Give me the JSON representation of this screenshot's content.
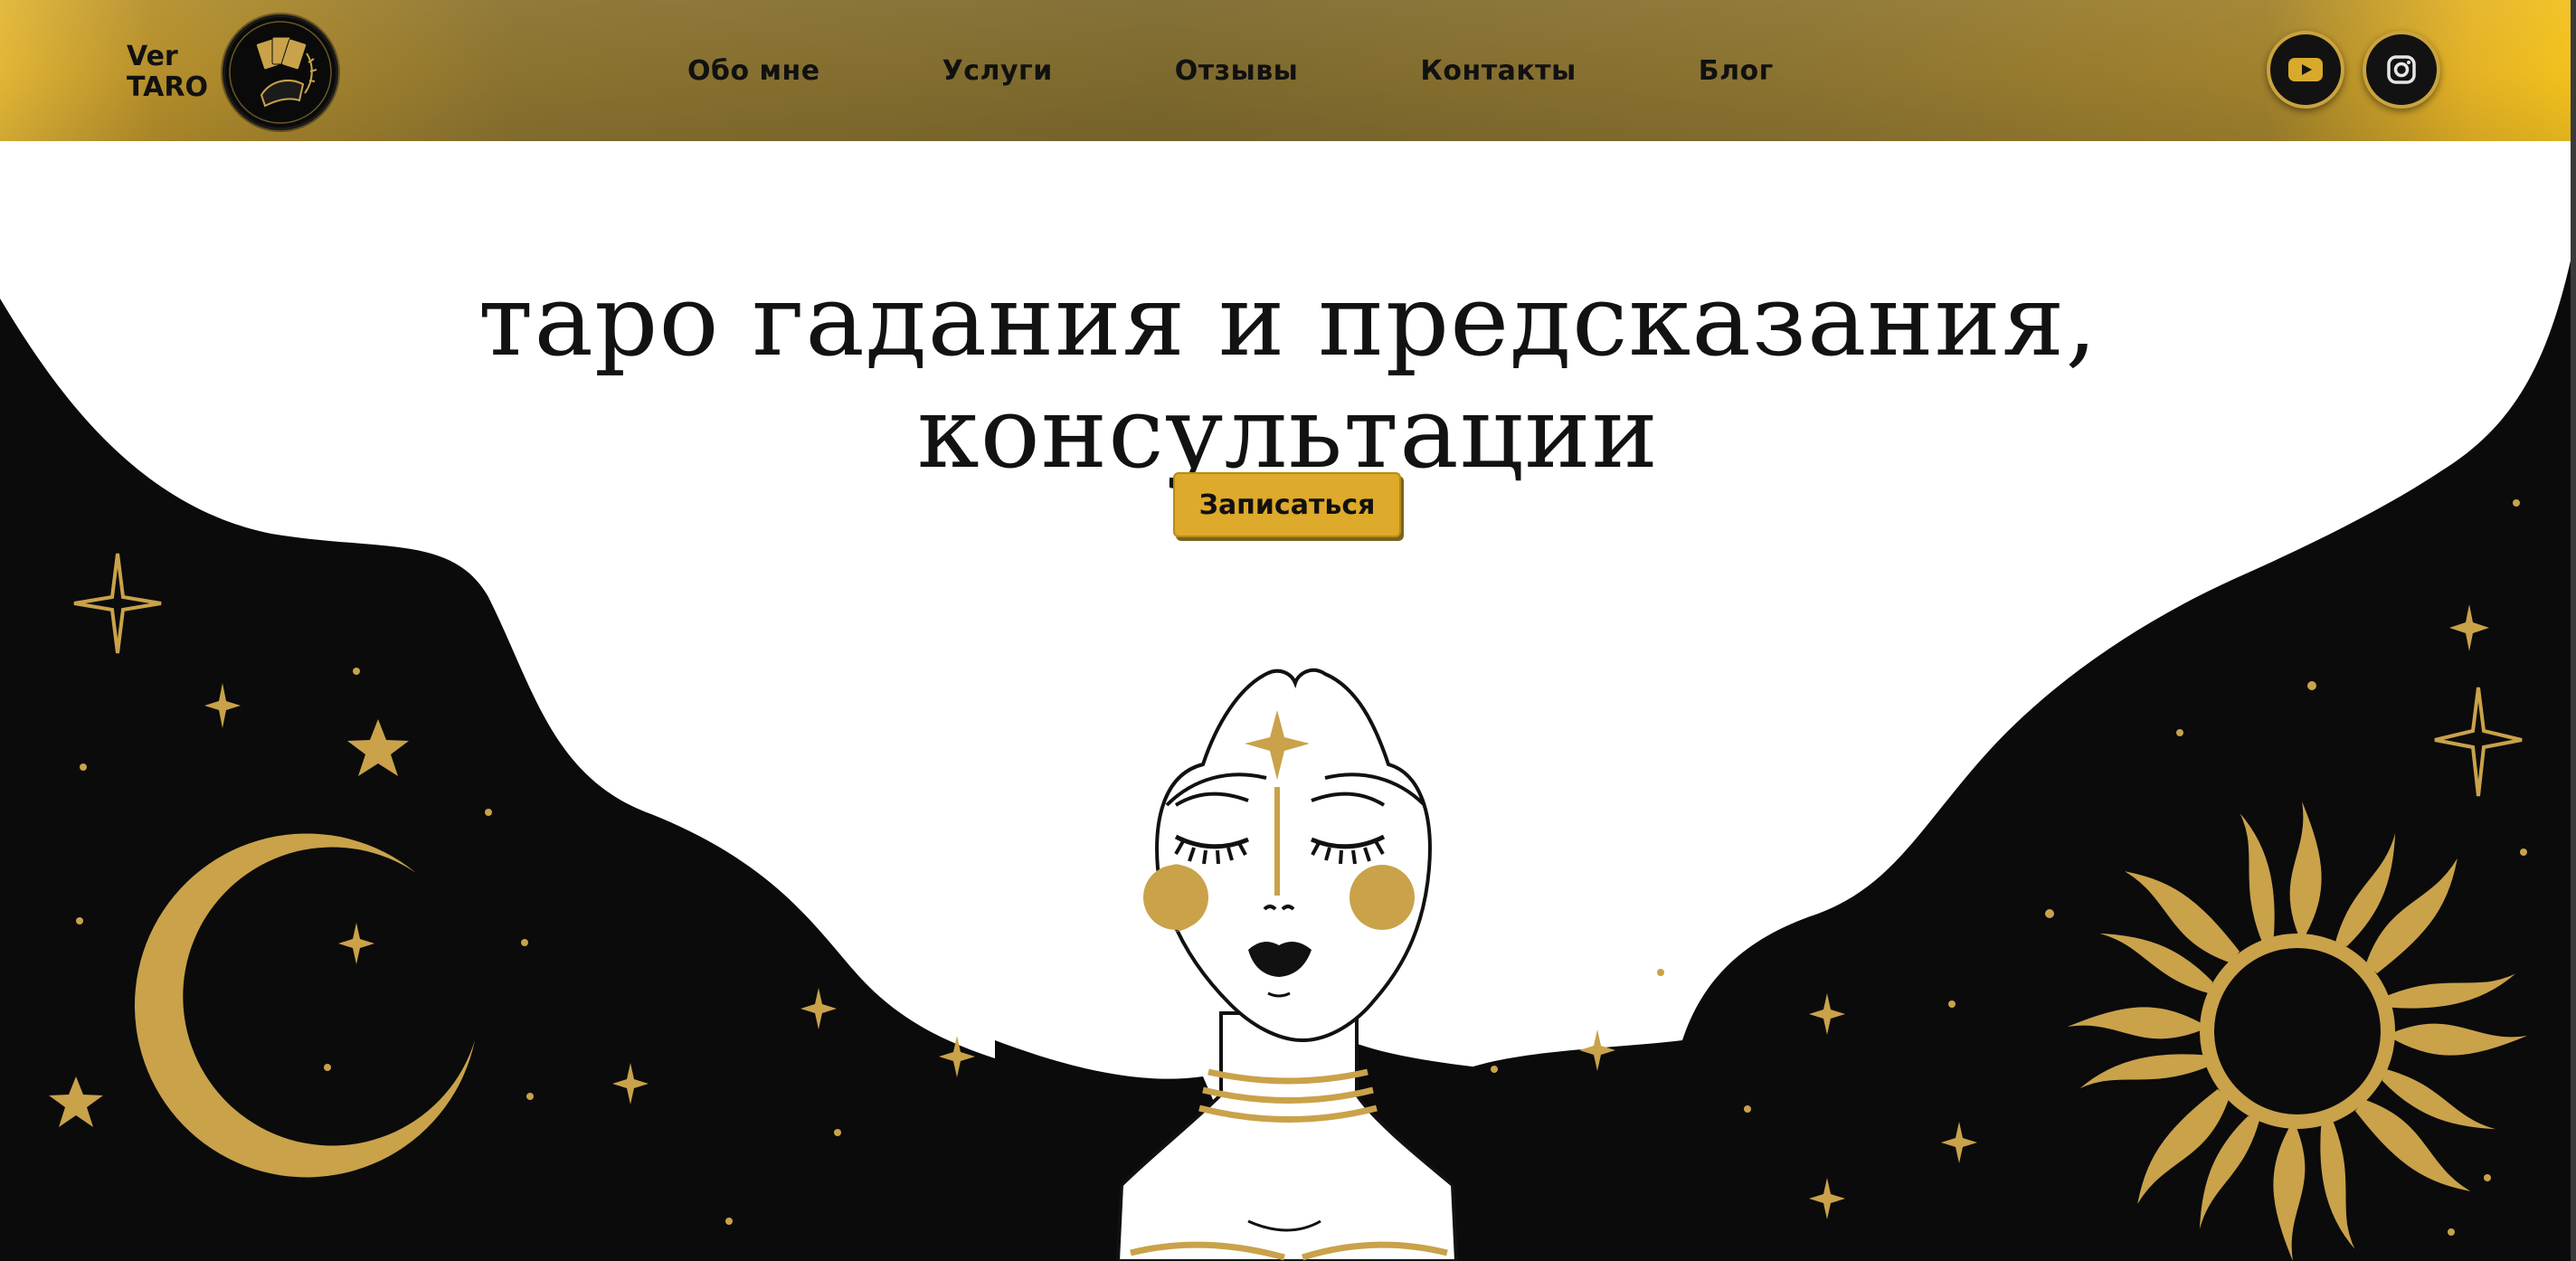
{
  "brand": {
    "line1": "Ver",
    "line2": "TARO"
  },
  "nav": {
    "items": [
      {
        "label": "Обо мне"
      },
      {
        "label": "Услуги"
      },
      {
        "label": "Отзывы"
      },
      {
        "label": "Контакты"
      },
      {
        "label": "Блог"
      }
    ]
  },
  "socials": {
    "items": [
      {
        "icon": "youtube-icon"
      },
      {
        "icon": "instagram-icon"
      }
    ]
  },
  "hero": {
    "title_line1": "таро гадания и предсказания,",
    "title_line2": "консультации",
    "cta_label": "Записаться"
  },
  "colors": {
    "gold": "#c9a24a",
    "dark": "#0b0b0c",
    "button": "#deaa2b"
  }
}
